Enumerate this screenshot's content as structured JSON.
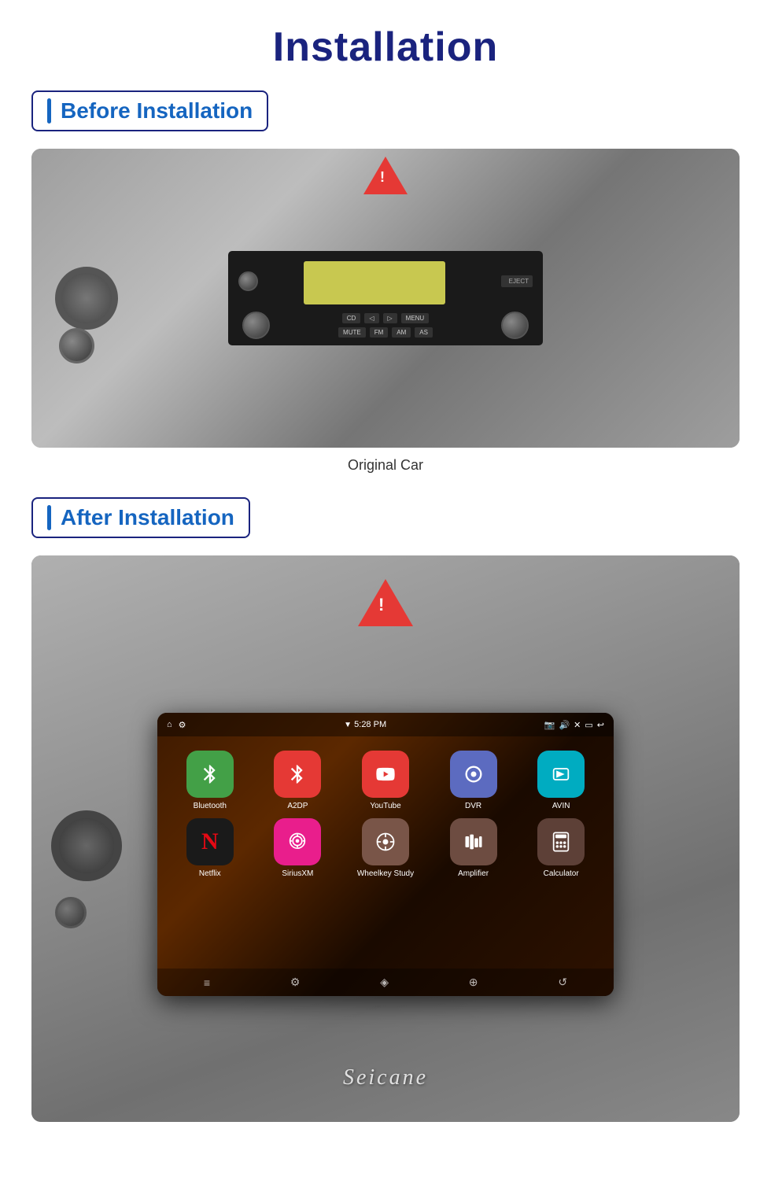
{
  "page": {
    "title": "Installation"
  },
  "before_section": {
    "label": "Before Installation",
    "caption": "Original Car"
  },
  "after_section": {
    "label": "After Installation"
  },
  "screen": {
    "status_bar": {
      "time": "5:28 PM",
      "wifi_icon": "▼",
      "home_icon": "⌂",
      "settings_icon": "⚙"
    },
    "apps_row1": [
      {
        "id": "bluetooth",
        "label": "Bluetooth",
        "icon": "✦",
        "bg_class": "app-bluetooth"
      },
      {
        "id": "a2dp",
        "label": "A2DP",
        "icon": "✦",
        "bg_class": "app-a2dp"
      },
      {
        "id": "youtube",
        "label": "YouTube",
        "icon": "▶",
        "bg_class": "app-youtube"
      },
      {
        "id": "dvr",
        "label": "DVR",
        "icon": "◎",
        "bg_class": "app-dvr"
      },
      {
        "id": "avin",
        "label": "AVIN",
        "icon": "↕",
        "bg_class": "app-avin"
      }
    ],
    "apps_row2": [
      {
        "id": "netflix",
        "label": "Netflix",
        "icon": "N",
        "bg_class": "app-netflix"
      },
      {
        "id": "siriusxm",
        "label": "SiriusXM",
        "icon": "((·))",
        "bg_class": "app-siriusxm"
      },
      {
        "id": "wheelkey",
        "label": "Wheelkey Study",
        "icon": "⊕",
        "bg_class": "app-wheelkey"
      },
      {
        "id": "amplifier",
        "label": "Amplifier",
        "icon": "▦",
        "bg_class": "app-amplifier"
      },
      {
        "id": "calculator",
        "label": "Calculator",
        "icon": "▦",
        "bg_class": "app-calculator"
      }
    ]
  },
  "branding": {
    "seicane": "Seicane"
  }
}
